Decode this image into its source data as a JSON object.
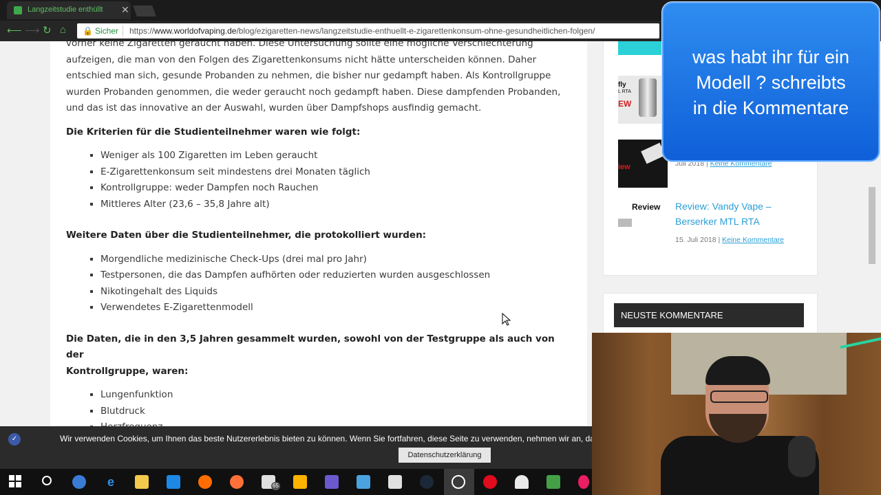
{
  "browser": {
    "tab_title": "Langzeitstudie enthüllt",
    "secure_label": "Sicher",
    "url_scheme": "https://",
    "url_host": "www.worldofvaping.de",
    "url_path": "/blog/ezigaretten-news/langzeitstudie-enthuellt-e-zigarettenkonsum-ohne-gesundheitlichen-folgen/"
  },
  "article": {
    "intro_lines": [
      "vorher keine Zigaretten geraucht haben. Diese Untersuchung sollte eine mögliche Verschlechterung",
      "aufzeigen, die man von den Folgen des Zigarettenkonsums nicht hätte unterscheiden können. Daher",
      "entschied man sich, gesunde Probanden zu nehmen, die bisher nur gedampft haben. Als Kontrollgruppe",
      "wurden Probanden genommen, die weder geraucht noch gedampft haben. Diese dampfenden Probanden,",
      "und das ist das innovative an der Auswahl, wurden über Dampfshops ausfindig gemacht."
    ],
    "criteria_heading": "Die Kriterien für die Studienteilnehmer waren wie folgt:",
    "criteria": [
      "Weniger als 100 Zigaretten im Leben geraucht",
      "E-Zigarettenkonsum seit mindestens drei Monaten täglich",
      "Kontrollgruppe: weder Dampfen noch Rauchen",
      "Mittleres Alter (23,6 – 35,8 Jahre alt)"
    ],
    "data_heading": "Weitere Daten über die Studienteilnehmer, die protokolliert wurden:",
    "data_items": [
      "Morgendliche medizinische Check-Ups (drei mal pro Jahr)",
      "Testpersonen, die das Dampfen aufhörten oder reduzierten wurden ausgeschlossen",
      "Nikotingehalt des Liquids",
      "Verwendetes E-Zigarettenmodell"
    ],
    "collected_heading_1": "Die Daten, die in den 3,5 Jahren gesammelt wurden, sowohl von der Testgruppe als auch von der",
    "collected_heading_2": "Kontrollgruppe, waren:",
    "collected": [
      "Lungenfunktion",
      "Blutdruck",
      "Herzfrequenz"
    ]
  },
  "sidebar": {
    "fly_text": "fly",
    "rta_text": "L RTA",
    "ew_text": "EW",
    "review_tag": "iew",
    "partial_meta": "Juli 2018",
    "partial_comments": "Keine Kommentare",
    "review_label": "Review",
    "post_title_1": "Review: Vandy Vape –",
    "post_title_2": "Berserker MTL RTA",
    "post_date": "15. Juli 2018",
    "post_sep": "|",
    "post_comments": "Keine Kommentare",
    "widget_title": "NEUSTE KOMMENTARE"
  },
  "overlay": {
    "line1": "was habt ihr für ein",
    "line2": "Modell ? schreibts",
    "line3": "in die Kommentare"
  },
  "cookie": {
    "text": "Wir verwenden Cookies, um Ihnen das beste Nutzererlebnis bieten zu können. Wenn Sie fortfahren, diese Seite zu verwenden, nehmen wir an, dass Sie damit einverstanden sind.",
    "button": "Datenschutzerklärung"
  },
  "taskbar": {
    "mail_badge": "65"
  }
}
